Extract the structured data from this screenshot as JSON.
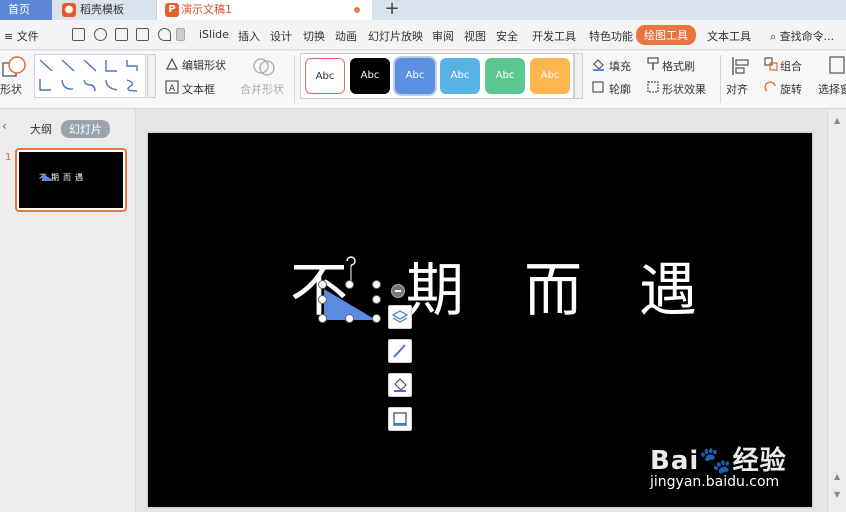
{
  "tabs": {
    "home": "首页",
    "template": "稻壳模板",
    "document": "演示文稿1",
    "add_icon": "+"
  },
  "menu": {
    "file": "≡ 文件",
    "items": [
      "iSlide",
      "插入",
      "设计",
      "切换",
      "动画",
      "幻灯片放映",
      "审阅",
      "视图",
      "安全",
      "开发工具",
      "特色功能"
    ],
    "drawing_tools": "绘图工具",
    "text_tools": "文本工具",
    "search": "查找命令..."
  },
  "ribbon": {
    "shapes": "形状",
    "edit_shape": "编辑形状",
    "text_box": "文本框",
    "merge_shapes": "合并形状",
    "styles": [
      "Abc",
      "Abc",
      "Abc",
      "Abc",
      "Abc",
      "Abc"
    ],
    "fill": "填充",
    "format_painter": "格式刷",
    "outline": "轮廓",
    "shape_effects": "形状效果",
    "align": "对齐",
    "group": "组合",
    "rotate": "旋转",
    "select_pane": "选择窗"
  },
  "left_pane": {
    "outline_tab": "大纲",
    "slides_tab": "幻灯片",
    "slide_number": "1",
    "thumb_text": "不期而遇"
  },
  "slide": {
    "chars": [
      "不",
      "期",
      "而",
      "遇"
    ]
  },
  "watermark": {
    "brand": "Bai🐾经验",
    "url": "jingyan.baidu.com"
  },
  "colors": {
    "accent": "#e8743f",
    "home_tab": "#5b87d6",
    "shape_fill": "#5b8be0",
    "style_swatches": [
      "#ffffff",
      "#000000",
      "#5b8fe0",
      "#57b3e6",
      "#5cc88f",
      "#ffb550"
    ]
  }
}
